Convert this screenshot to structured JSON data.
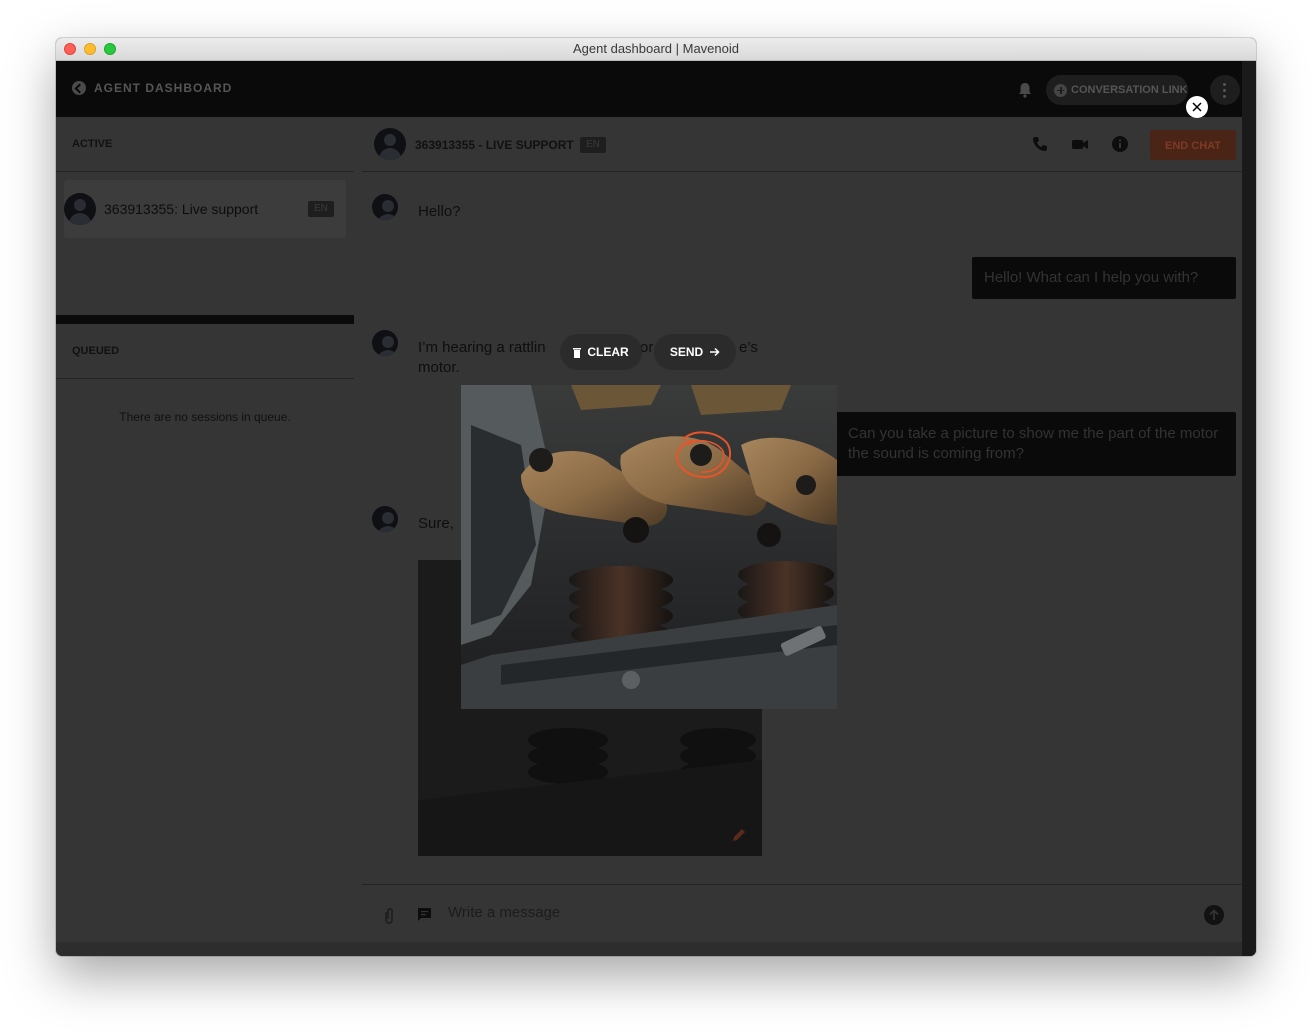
{
  "window": {
    "title": "Agent dashboard | Mavenoid"
  },
  "topbar": {
    "back_label": "AGENT DASHBOARD",
    "conversation_link_label": "CONVERSATION LINK"
  },
  "active_panel": {
    "heading": "ACTIVE",
    "sessions": [
      {
        "name": "363913355: Live support",
        "lang": "EN"
      }
    ]
  },
  "queued_panel": {
    "heading": "QUEUED",
    "empty_text": "There are no sessions in queue."
  },
  "chat": {
    "title": "363913355 - LIVE SUPPORT",
    "lang": "EN",
    "end_chat_label": "END CHAT",
    "messages": [
      {
        "from": "customer",
        "text": "Hello?"
      },
      {
        "from": "agent",
        "text": "Hello! What can I help you with?"
      },
      {
        "from": "customer",
        "text_part1": "I’m hearing a rattlin",
        "text_part2": "or",
        "text_part3": "e’s",
        "text_part4": "motor."
      },
      {
        "from": "agent",
        "text": "Can you take a picture to show me the part of the motor the sound is coming from?"
      },
      {
        "from": "customer",
        "text": "Sure,"
      }
    ],
    "composer_placeholder": "Write a message"
  },
  "annotation_overlay": {
    "clear_label": "CLEAR",
    "send_label": "SEND"
  },
  "colors": {
    "end_chat": "#e05a2e",
    "annotation_stroke": "#e8542a",
    "overlay": "rgba(0,0,0,0.78)"
  },
  "icons": [
    "back-arrow-icon",
    "bell-icon",
    "plus-circle-icon",
    "kebab-menu-icon",
    "phone-icon",
    "video-icon",
    "info-icon",
    "attachment-icon",
    "chat-bubble-icon",
    "send-arrow-icon",
    "pencil-icon",
    "close-icon",
    "trash-icon",
    "arrow-right-icon"
  ]
}
